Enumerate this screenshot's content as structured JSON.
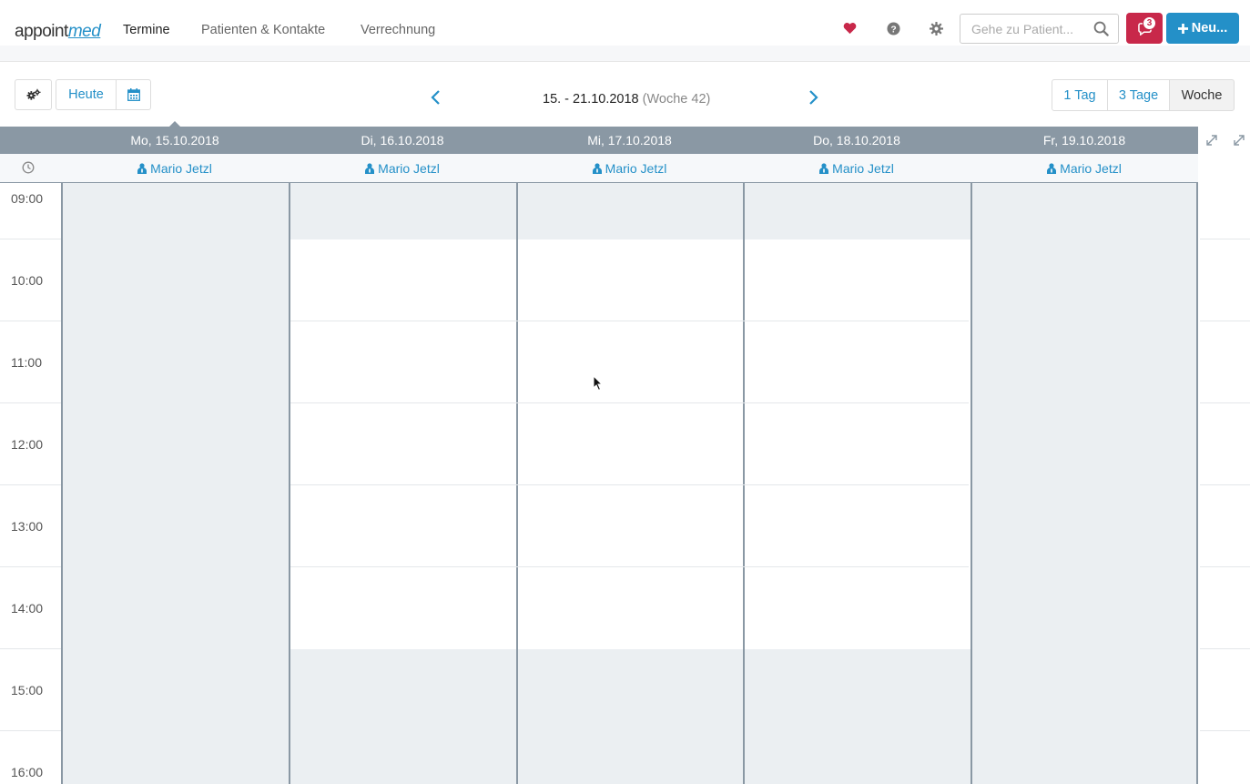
{
  "app": {
    "logo_part1": "appoint",
    "logo_part2": "med"
  },
  "nav": {
    "tabs": [
      "Termine",
      "Patienten & Kontakte",
      "Verrechnung"
    ],
    "active_tab": "Termine",
    "search_placeholder": "Gehe zu Patient...",
    "notification_count": "3",
    "new_button_label": "Neu...",
    "icons": [
      "heart-icon",
      "help-icon",
      "gear-icon",
      "search-icon",
      "chat-icon",
      "plus-icon"
    ]
  },
  "toolbar": {
    "today_label": "Heute",
    "date_range": "15. - 21.10.2018",
    "week_label": "(Woche 42)",
    "views": [
      "1 Tag",
      "3 Tage",
      "Woche"
    ],
    "active_view": "Woche"
  },
  "calendar": {
    "days": [
      {
        "label": "Mo, 15.10.2018",
        "resource": "Mario Jetzl"
      },
      {
        "label": "Di, 16.10.2018",
        "resource": "Mario Jetzl"
      },
      {
        "label": "Mi, 17.10.2018",
        "resource": "Mario Jetzl"
      },
      {
        "label": "Do, 18.10.2018",
        "resource": "Mario Jetzl"
      },
      {
        "label": "Fr, 19.10.2018",
        "resource": "Mario Jetzl"
      }
    ],
    "hours": [
      "09:00",
      "10:00",
      "11:00",
      "12:00",
      "13:00",
      "14:00",
      "15:00",
      "16:00"
    ],
    "colors": {
      "header": "#8a98a4",
      "closed": "#ebeff2",
      "open": "#ffffff",
      "accent": "#2490c8",
      "danger": "#c8284a"
    }
  }
}
